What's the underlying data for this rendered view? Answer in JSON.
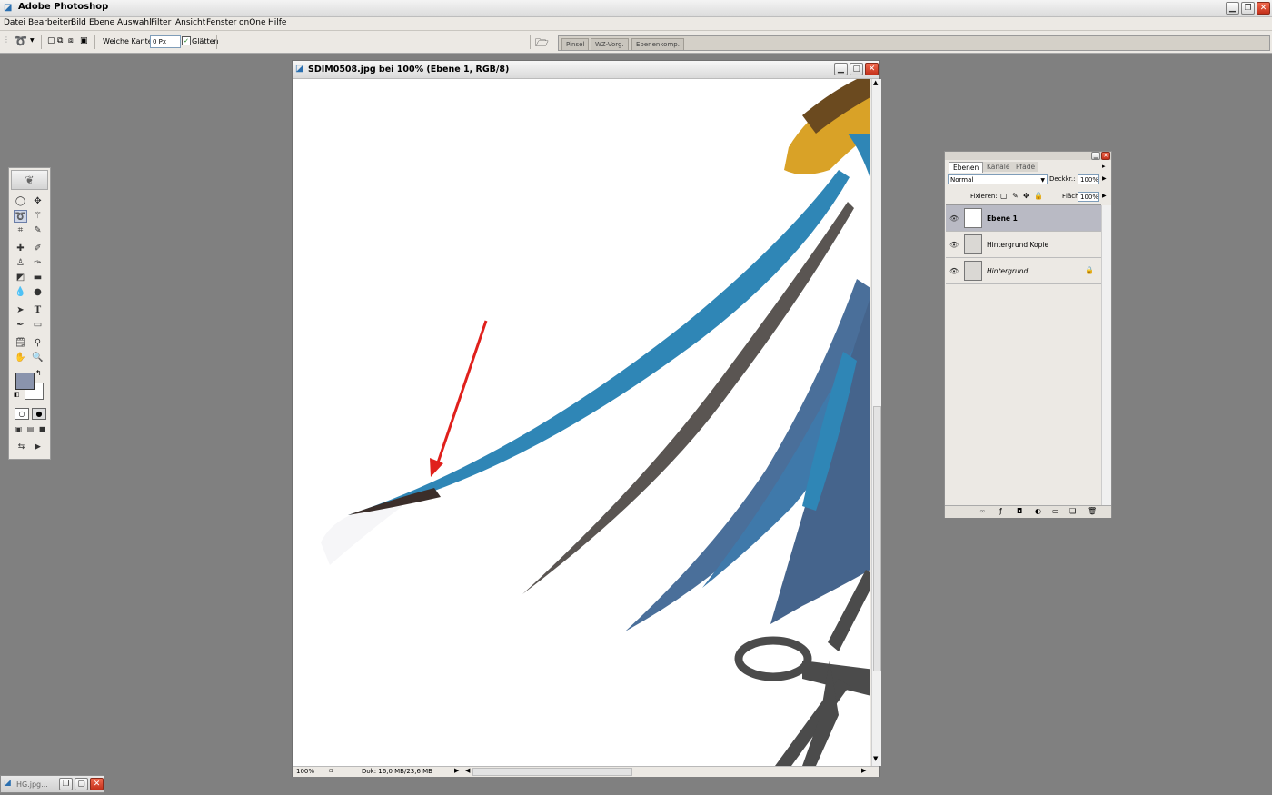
{
  "app": {
    "title": "Adobe Photoshop"
  },
  "menu": [
    "Datei",
    "Bearbeiten",
    "Bild",
    "Ebene",
    "Auswahl",
    "Filter",
    "Ansicht",
    "Fenster",
    "onOne",
    "Hilfe"
  ],
  "options": {
    "feather_label": "Weiche Kante:",
    "feather_value": "0 Px",
    "antialias_label": "Glätten",
    "antialias_checked": true
  },
  "palette_well": {
    "tabs": [
      "Pinsel",
      "WZ-Vorg.",
      "Ebenenkomp."
    ]
  },
  "document": {
    "title": "SDIM0508.jpg bei 100% (Ebene 1, RGB/8)",
    "zoom": "100%",
    "doc_size": "Dok: 16,0 MB/23,6 MB"
  },
  "layers_panel": {
    "tabs": [
      "Ebenen",
      "Kanäle",
      "Pfade"
    ],
    "blend_mode": "Normal",
    "opacity_label": "Deckkr.:",
    "opacity_value": "100%",
    "lock_label": "Fixieren:",
    "fill_label": "Fläche:",
    "fill_value": "100%",
    "layers": [
      {
        "name": "Ebene 1",
        "selected": true
      },
      {
        "name": "Hintergrund Kopie",
        "selected": false
      },
      {
        "name": "Hintergrund",
        "selected": false,
        "locked": true
      }
    ]
  },
  "minimized_window": {
    "title": "HG.jpg..."
  },
  "colors": {
    "foreground": "#8a94ad",
    "background": "#ffffff",
    "annotation_arrow": "#e0201c",
    "feather": "#2f86b6"
  },
  "icons": {
    "tools": [
      "marquee-icon",
      "move-icon",
      "lasso-icon",
      "magic-wand-icon",
      "crop-icon",
      "slice-icon",
      "healing-brush-icon",
      "brush-icon",
      "clone-stamp-icon",
      "history-brush-icon",
      "eraser-icon",
      "gradient-icon",
      "blur-icon",
      "dodge-icon",
      "path-select-icon",
      "type-icon",
      "pen-icon",
      "shape-icon",
      "notes-icon",
      "eyedropper-icon",
      "hand-icon",
      "zoom-icon"
    ]
  }
}
